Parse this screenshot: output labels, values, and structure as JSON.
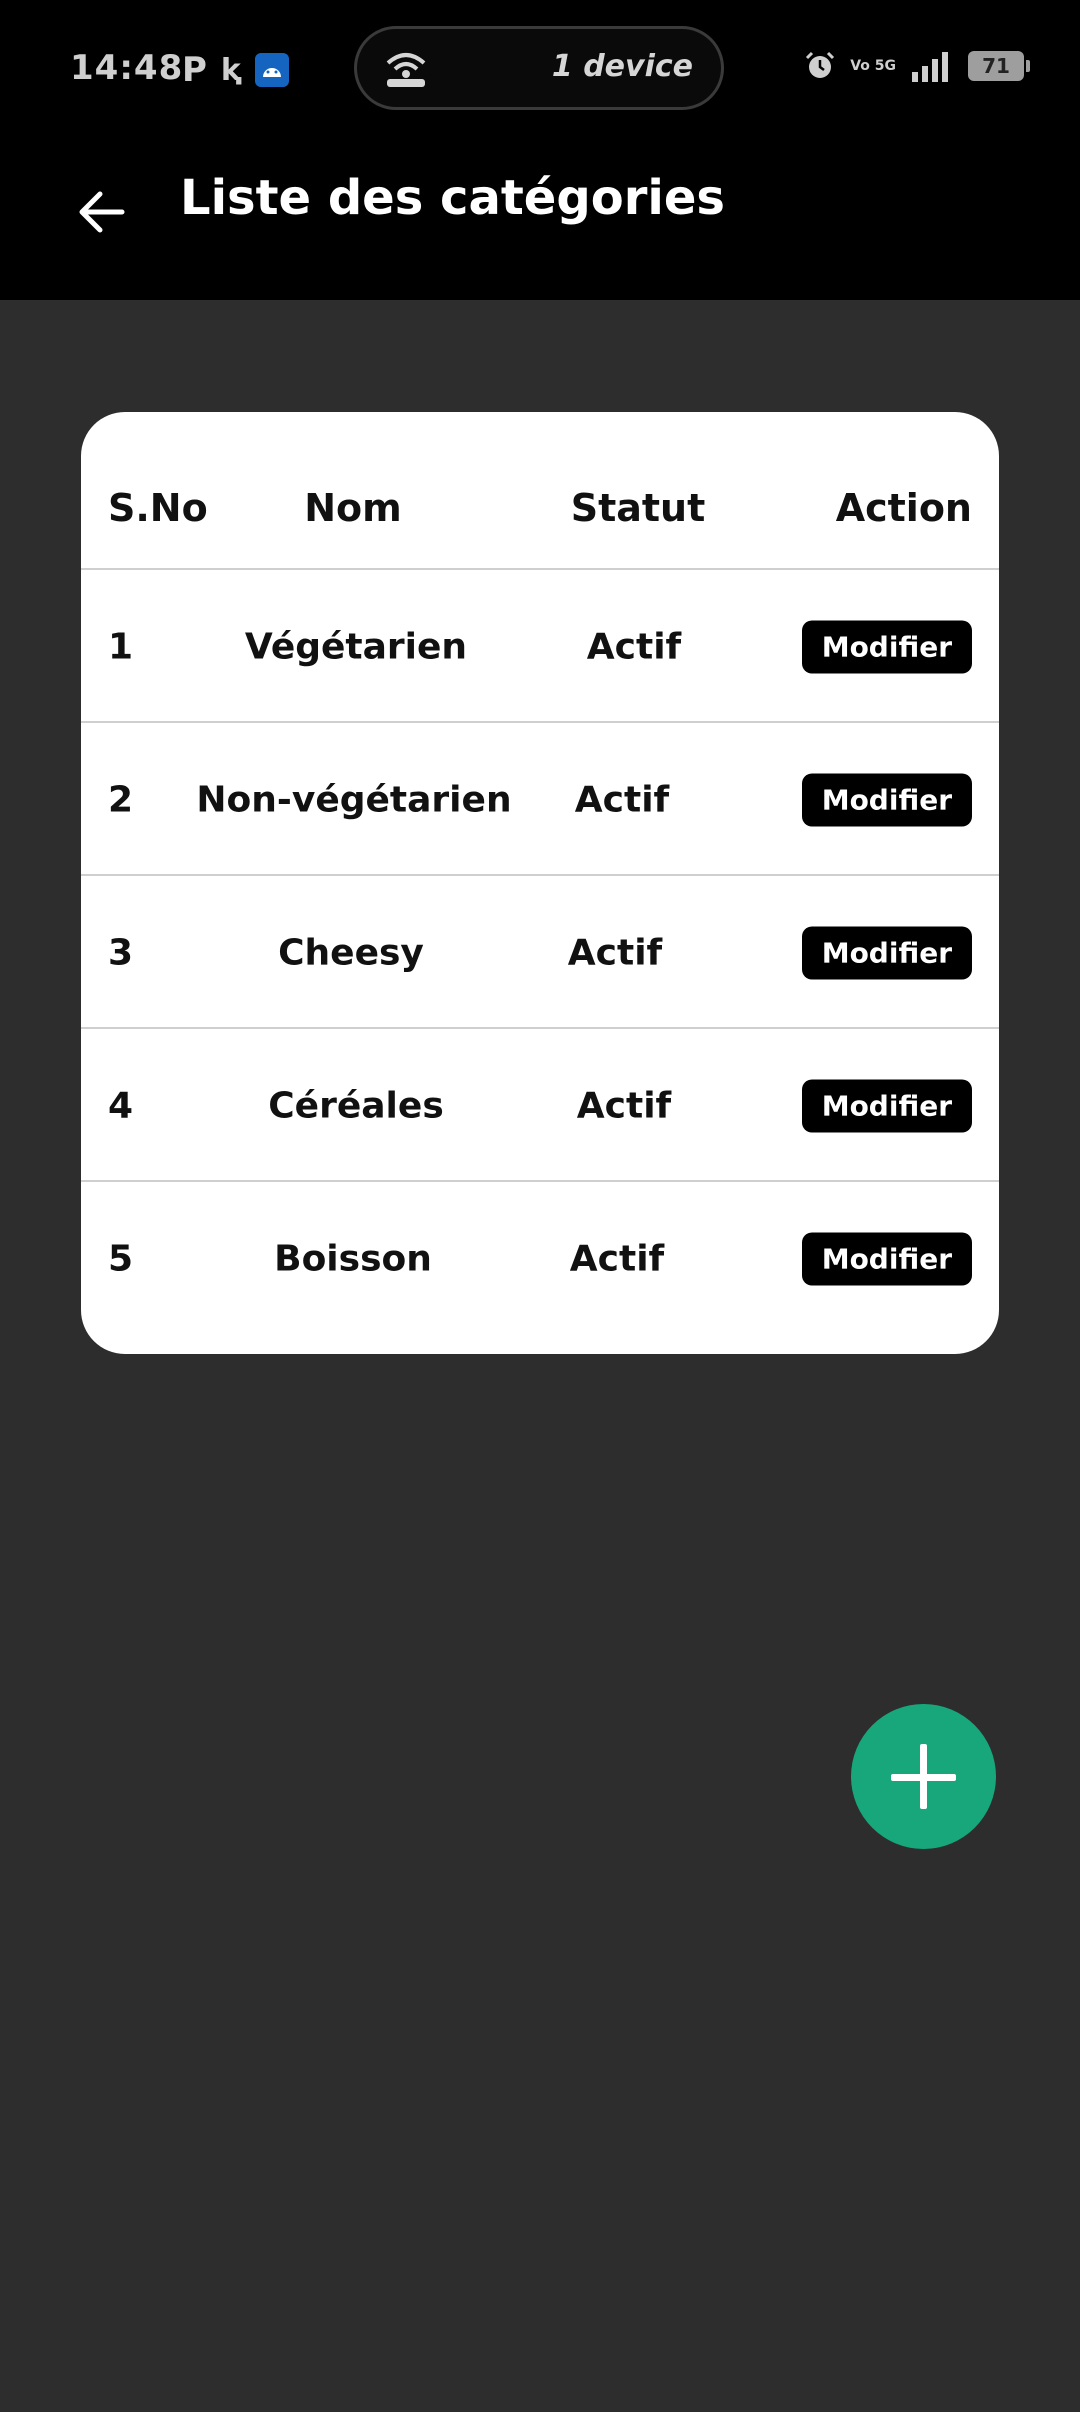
{
  "status_bar": {
    "time": "14:48",
    "left_icons": [
      "p-icon",
      "k-icon",
      "android-icon"
    ],
    "pill_label": "1 device",
    "signal_text": "Vo 5G",
    "battery": "71"
  },
  "app_bar": {
    "title": "Liste des catégories",
    "back_icon": "arrow-left-icon"
  },
  "table": {
    "headers": [
      "S.No",
      "Nom",
      "Statut",
      "Action"
    ],
    "rows": [
      {
        "no": "1",
        "nom": "Végétarien",
        "statut": "Actif",
        "action": "Modifier"
      },
      {
        "no": "2",
        "nom": "Non-végétarien",
        "statut": "Actif",
        "action": "Modifier"
      },
      {
        "no": "3",
        "nom": "Cheesy",
        "statut": "Actif",
        "action": "Modifier"
      },
      {
        "no": "4",
        "nom": "Céréales",
        "statut": "Actif",
        "action": "Modifier"
      },
      {
        "no": "5",
        "nom": "Boisson",
        "statut": "Actif",
        "action": "Modifier"
      }
    ]
  },
  "fab": {
    "icon": "plus-icon"
  },
  "colors": {
    "background": "#2d2d2d",
    "bar": "#000000",
    "accent": "#17a77b",
    "card": "#ffffff"
  }
}
